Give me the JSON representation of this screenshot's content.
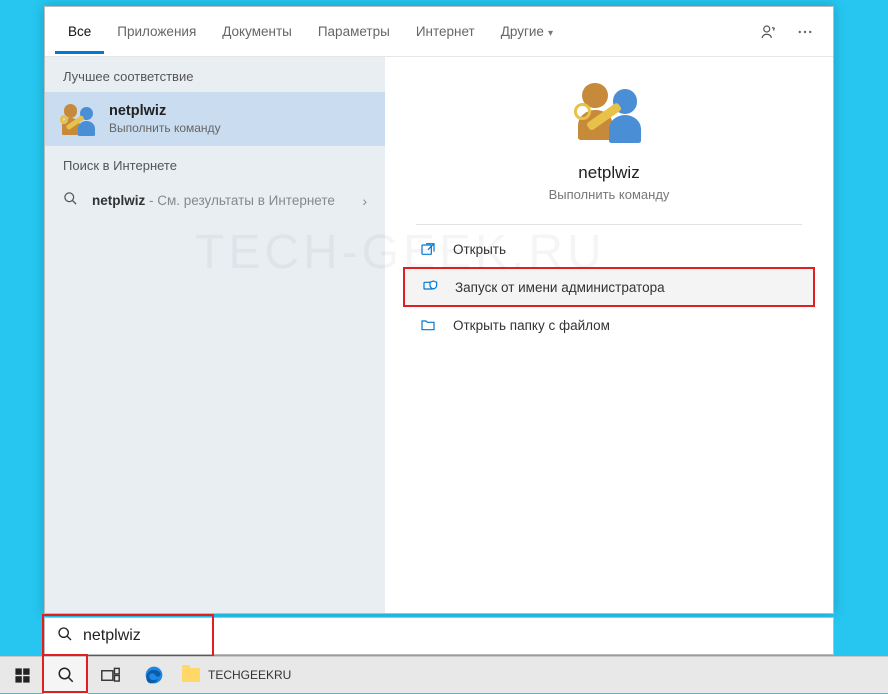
{
  "watermark": "TECH-GEEK.RU",
  "tabs": {
    "all": "Все",
    "apps": "Приложения",
    "docs": "Документы",
    "settings": "Параметры",
    "web": "Интернет",
    "more": "Другие"
  },
  "left": {
    "best_match_label": "Лучшее соответствие",
    "best_title": "netplwiz",
    "best_sub": "Выполнить команду",
    "web_search_label": "Поиск в Интернете",
    "web_item_name": "netplwiz",
    "web_item_suffix": " - См. результаты в Интернете"
  },
  "right": {
    "title": "netplwiz",
    "sub": "Выполнить команду",
    "actions": {
      "open": "Открыть",
      "run_admin": "Запуск от имени администратора",
      "open_folder": "Открыть папку с файлом"
    }
  },
  "search": {
    "value": "netplwiz"
  },
  "taskbar": {
    "folder_label": "TECHGEEKRU"
  }
}
